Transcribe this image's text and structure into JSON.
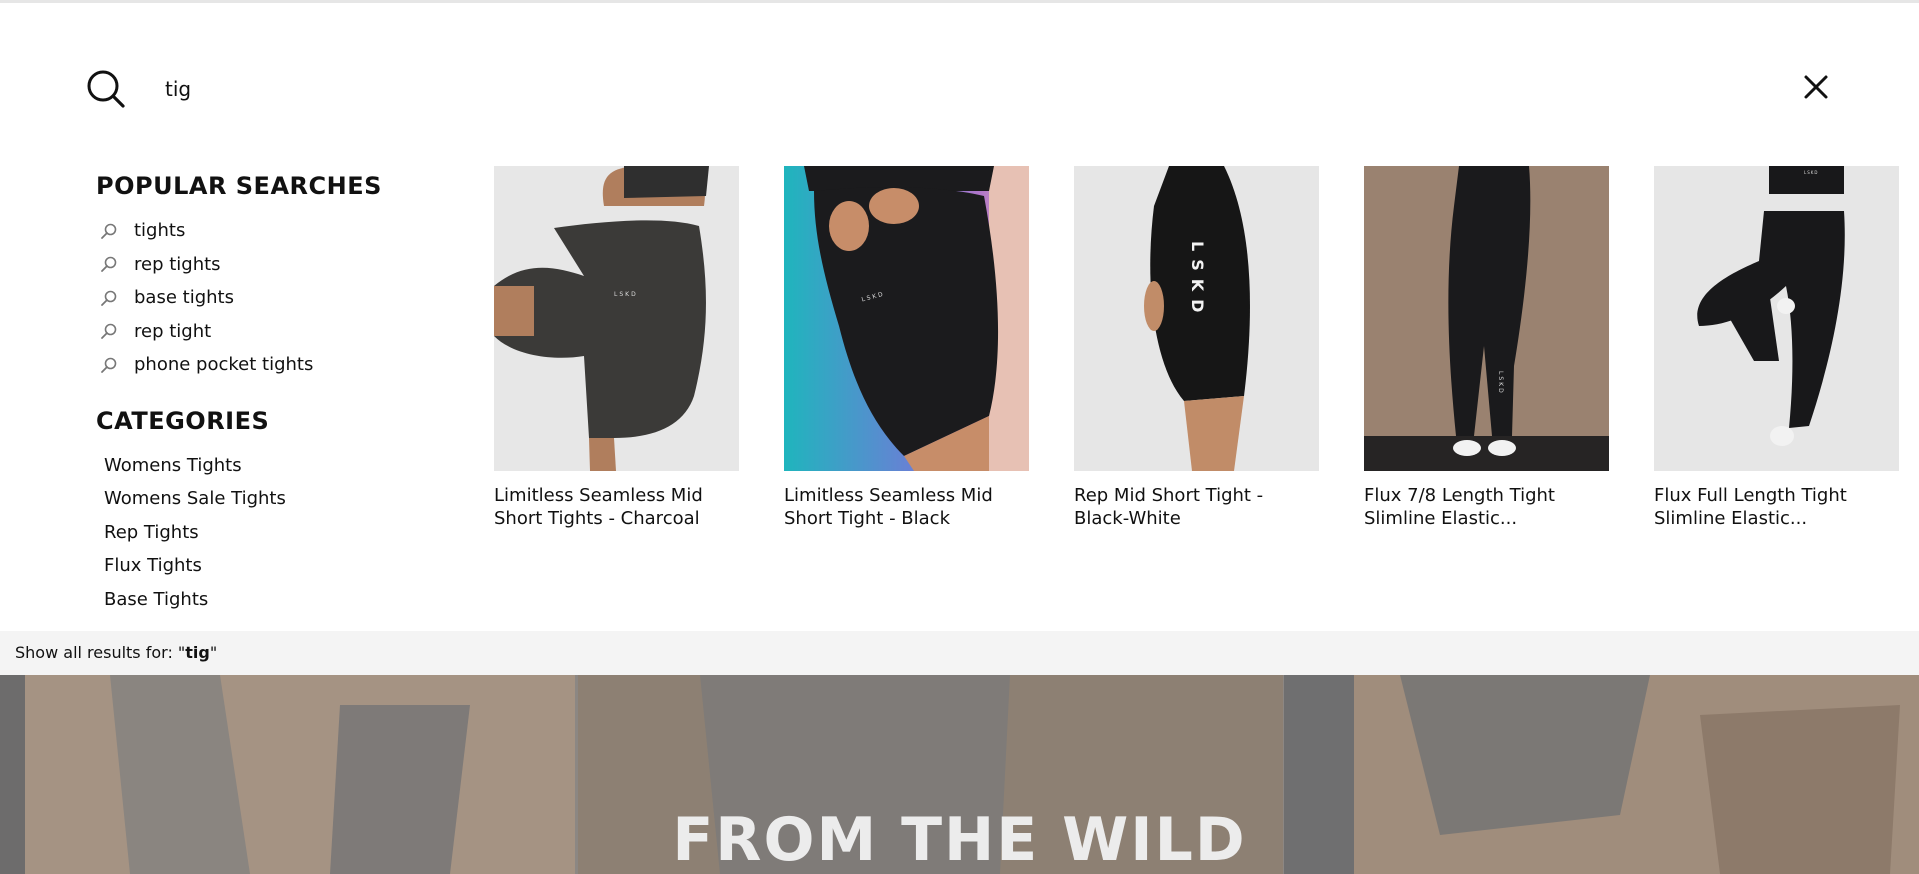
{
  "search": {
    "value": "tig",
    "icon": "search-icon",
    "close_icon": "close-icon"
  },
  "popular": {
    "title": "POPULAR SEARCHES",
    "items": [
      {
        "label": "tights"
      },
      {
        "label": "rep tights"
      },
      {
        "label": "base tights"
      },
      {
        "label": "rep tight"
      },
      {
        "label": "phone pocket tights"
      }
    ]
  },
  "categories": {
    "title": "CATEGORIES",
    "items": [
      {
        "label": "Womens Tights"
      },
      {
        "label": "Womens Sale Tights"
      },
      {
        "label": "Rep Tights"
      },
      {
        "label": "Flux Tights"
      },
      {
        "label": "Base Tights"
      }
    ]
  },
  "products": [
    {
      "line1": "Limitless Seamless Mid",
      "line2": "Short Tights - Charcoal",
      "color": "#3c3b39"
    },
    {
      "line1": "Limitless Seamless Mid",
      "line2": "Short Tight - Black",
      "color": "#1b1b1d"
    },
    {
      "line1": "Rep Mid Short Tight -",
      "line2": "Black-White",
      "color": "#161616",
      "logo": "LSKD"
    },
    {
      "line1": "Flux 7/8 Length Tight",
      "line2": "Slimline Elastic...",
      "color": "#1a1a1c"
    },
    {
      "line1": "Flux Full Length Tight",
      "line2": "Slimline Elastic...",
      "color": "#18181a"
    }
  ],
  "show_all": {
    "prefix": "Show all results for: \"",
    "query": "tig",
    "suffix": "\""
  },
  "hero": {
    "title": "FROM THE WILD"
  }
}
